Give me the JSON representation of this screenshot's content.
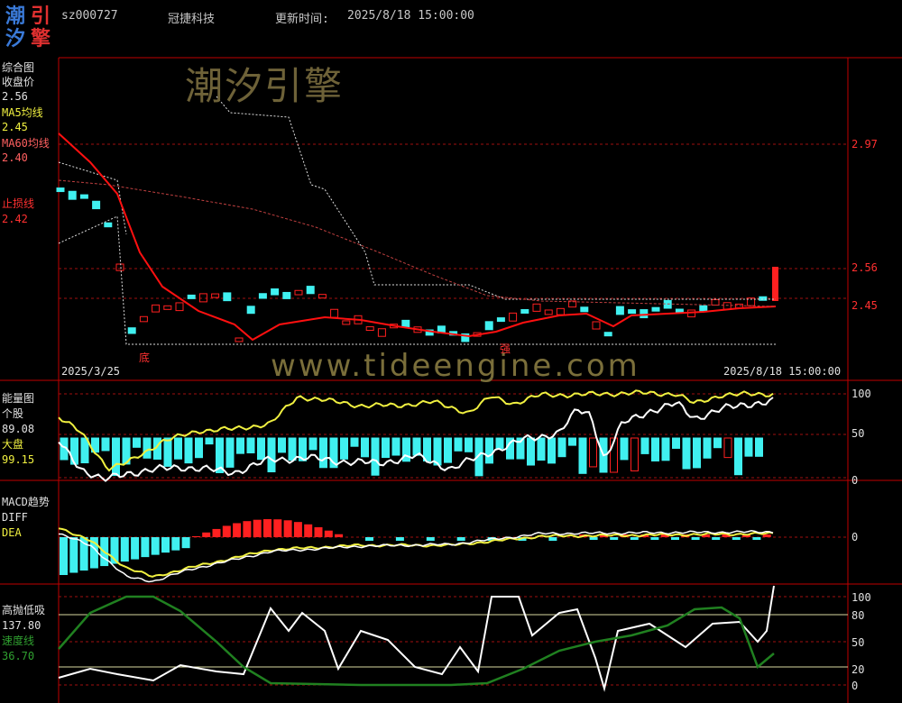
{
  "header": {
    "logo_chars": [
      "潮",
      "引",
      "汐",
      "擎"
    ],
    "stock_code": "sz000727",
    "stock_name": "冠捷科技",
    "update_label": "更新时间:",
    "update_time": "2025/8/18 15:00:00"
  },
  "watermark": {
    "text1": "潮汐引擎",
    "text2": "www.tideengine.com"
  },
  "colors": {
    "up": "#ff2020",
    "down": "#40f0f0",
    "ma5": "#f0f040",
    "ma60": "#ff5050",
    "bg": "#000000",
    "axis": "#c00000"
  },
  "main_panel": {
    "title": "综合图",
    "close_label": "收盘价",
    "close_value": "2.56",
    "ma5_label": "MA5均线",
    "ma5_value": "2.45",
    "ma60_label": "MA60均线",
    "ma60_value": "2.40",
    "stop_label": "止损线",
    "stop_value": "2.42",
    "ticks": [
      "2.97",
      "2.56",
      "2.45"
    ],
    "start_date": "2025/3/25",
    "end_date": "2025/8/18 15:00:00",
    "mark_bottom": "底",
    "mark_strong": "强"
  },
  "energy_panel": {
    "title": "能量图",
    "stock_label": "个股",
    "stock_value": "89.08",
    "market_label": "大盘",
    "market_value": "99.15",
    "ticks": [
      "100",
      "50",
      "0"
    ]
  },
  "macd_panel": {
    "title": "MACD趋势",
    "diff_label": "DIFF",
    "dea_label": "DEA",
    "ticks": [
      "0"
    ]
  },
  "highlow_panel": {
    "title": "高抛低吸",
    "value_main": "137.80",
    "speed_label": "速度线",
    "speed_value": "36.70",
    "ticks": [
      "100",
      "80",
      "50",
      "20",
      "0"
    ]
  },
  "chart_data": {
    "type": "line",
    "x_start": "2025/3/25",
    "x_end": "2025/8/18",
    "series": [
      {
        "name": "收盘价",
        "last": 2.56
      },
      {
        "name": "MA5均线",
        "last": 2.45
      },
      {
        "name": "MA60均线",
        "last": 2.4
      },
      {
        "name": "止损线",
        "last": 2.42
      },
      {
        "name": "个股",
        "last": 89.08
      },
      {
        "name": "大盘",
        "last": 99.15
      },
      {
        "name": "速度线",
        "last": 36.7
      }
    ],
    "y_ticks_main": [
      2.97,
      2.56,
      2.45
    ],
    "y_ticks_energy": [
      100,
      50,
      0
    ],
    "y_ticks_highlow": [
      100,
      80,
      50,
      20,
      0
    ]
  }
}
